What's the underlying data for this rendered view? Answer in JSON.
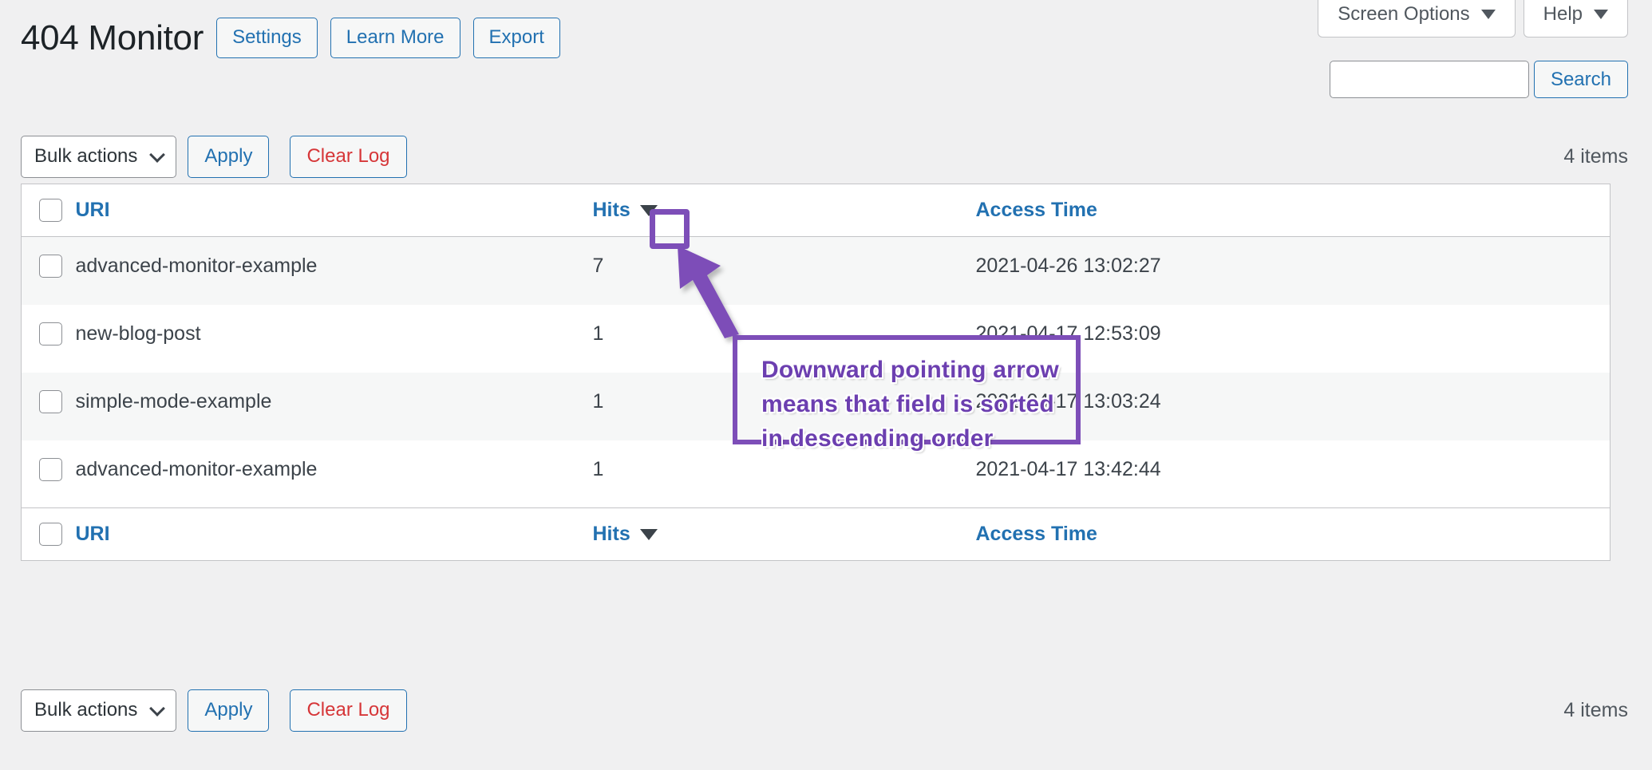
{
  "screen_meta": {
    "screen_options_label": "Screen Options",
    "help_label": "Help"
  },
  "header": {
    "page_title": "404 Monitor",
    "actions": [
      {
        "label": "Settings"
      },
      {
        "label": "Learn More"
      },
      {
        "label": "Export"
      }
    ]
  },
  "search": {
    "value": "",
    "placeholder": "",
    "button_label": "Search"
  },
  "toolbar": {
    "bulk_actions_label": "Bulk actions",
    "apply_label": "Apply",
    "clear_log_label": "Clear Log",
    "items_count_label": "4 items"
  },
  "table": {
    "columns": {
      "uri": "URI",
      "hits": "Hits",
      "access_time": "Access Time"
    },
    "sorted_column": "hits",
    "sort_direction": "descending",
    "rows": [
      {
        "uri": "advanced-monitor-example",
        "hits": "7",
        "access_time": "2021-04-26 13:02:27"
      },
      {
        "uri": "new-blog-post",
        "hits": "1",
        "access_time": "2021-04-17 12:53:09"
      },
      {
        "uri": "simple-mode-example",
        "hits": "1",
        "access_time": "2021-04-17 13:03:24"
      },
      {
        "uri": "advanced-monitor-example",
        "hits": "1",
        "access_time": "2021-04-17 13:42:44"
      }
    ]
  },
  "annotation": {
    "text": "Downward pointing arrow means that field is sorted in descending order",
    "color": "#7d4eb8",
    "text_color": "#6c3fb0"
  },
  "colors": {
    "link": "#2271b1",
    "danger": "#d63638",
    "page_bg": "#f0f0f1",
    "row_alt": "#f6f7f7",
    "border": "#c3c4c7"
  }
}
